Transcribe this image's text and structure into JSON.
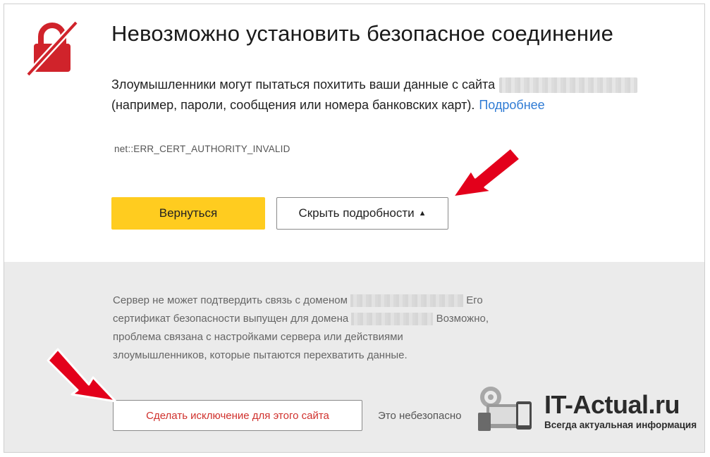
{
  "error_page": {
    "title": "Невозможно установить безопасное соединение",
    "description_line1": "Злоумышленники могут пытаться похитить ваши данные с сайта",
    "description_line2": "(например, пароли, сообщения или номера банковских карт).",
    "more_link": "Подробнее",
    "error_code": "net::ERR_CERT_AUTHORITY_INVALID",
    "back_button": "Вернуться",
    "hide_details_button": "Скрыть подробности",
    "hide_details_arrow": "▲"
  },
  "details": {
    "row1_start": "Сервер не может подтвердить связь с доменом",
    "row1_end": "Его",
    "row2_start": "сертификат безопасности выпущен для домена",
    "row2_end": "Возможно,",
    "row3": "проблема связана с настройками сервера или действиями",
    "row4": "злоумышленников, которые пытаются перехватить данные.",
    "exception_button": "Сделать исключение для этого сайта",
    "unsafe_label": "Это небезопасно"
  },
  "watermark": {
    "title": "IT-Actual.ru",
    "subtitle": "Всегда актуальная информация"
  },
  "colors": {
    "accent_yellow": "#ffcc1f",
    "link_blue": "#2f7bd4",
    "danger_red": "#d0312d",
    "arrow_red": "#e3001b",
    "details_bg": "#ebebeb"
  },
  "icons": {
    "lock": "broken-lock-icon",
    "arrow": "red-arrow-icon",
    "watermark": "devices-gear-icon"
  }
}
